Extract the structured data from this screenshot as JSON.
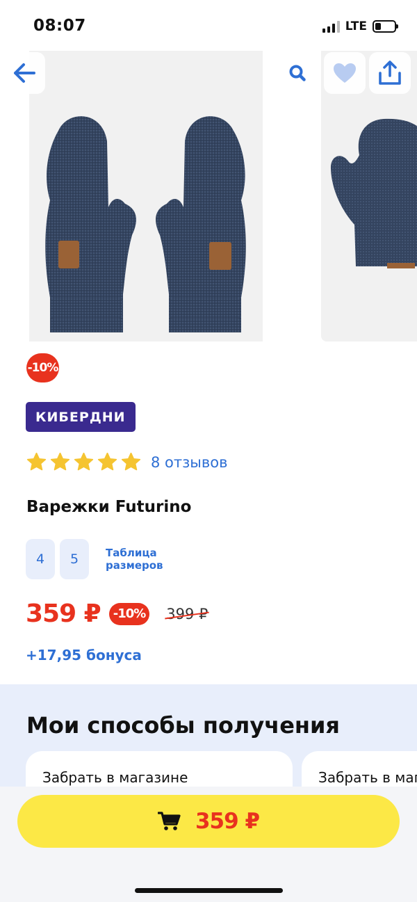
{
  "status_bar": {
    "time": "08:07",
    "network": "LTE"
  },
  "product": {
    "discount_badge": "-10%",
    "promo_label": "КИБЕРДНИ",
    "rating_stars": 5,
    "reviews": "8 отзывов",
    "title": "Варежки Futurino",
    "sizes": [
      "4",
      "5"
    ],
    "size_table": "Таблица размеров",
    "price": "359 ₽",
    "price_discount": "-10%",
    "old_price": "399 ₽",
    "bonus": "+17,95 бонуса"
  },
  "delivery": {
    "heading": "Мои способы получения",
    "cards": [
      "Забрать в магазине",
      "Забрать в магазине"
    ]
  },
  "bottom_bar": {
    "button_price": "359 ₽"
  },
  "colors": {
    "accent_blue": "#2e6fd4",
    "sale_red": "#e8321e",
    "promo_purple": "#3a2a8f",
    "buy_yellow": "#fce846",
    "star": "#f5c431"
  }
}
